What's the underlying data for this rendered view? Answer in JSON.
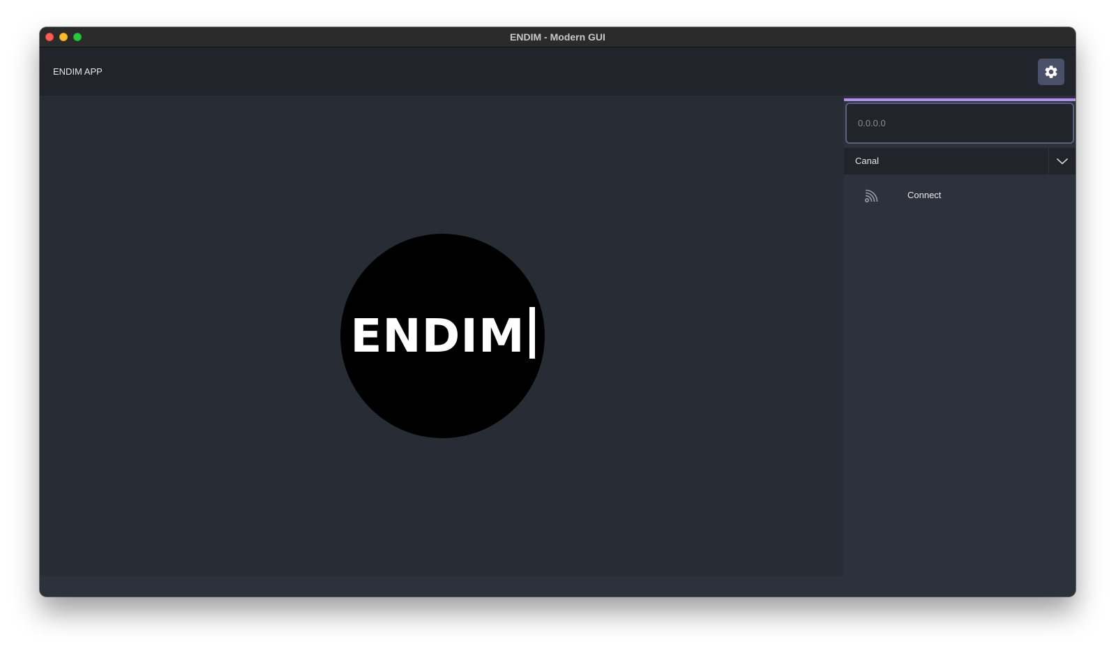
{
  "window": {
    "title": "ENDIM - Modern GUI"
  },
  "header": {
    "app_title": "ENDIM APP",
    "settings_icon": "gear-icon"
  },
  "main": {
    "logo_text": "ENDIM"
  },
  "sidebar": {
    "ip_placeholder": "0.0.0.0",
    "ip_value": "",
    "channel_selected": "Canal",
    "channel_arrow_icon": "chevron-down-icon",
    "connect_label": "Connect",
    "connect_icon": "signal-icon"
  },
  "colors": {
    "accent": "#b48eef",
    "header_bg": "#21252b",
    "content_bg": "#282c34",
    "sidebar_bg": "#2c313c",
    "settings_button_bg": "#4a5068"
  }
}
